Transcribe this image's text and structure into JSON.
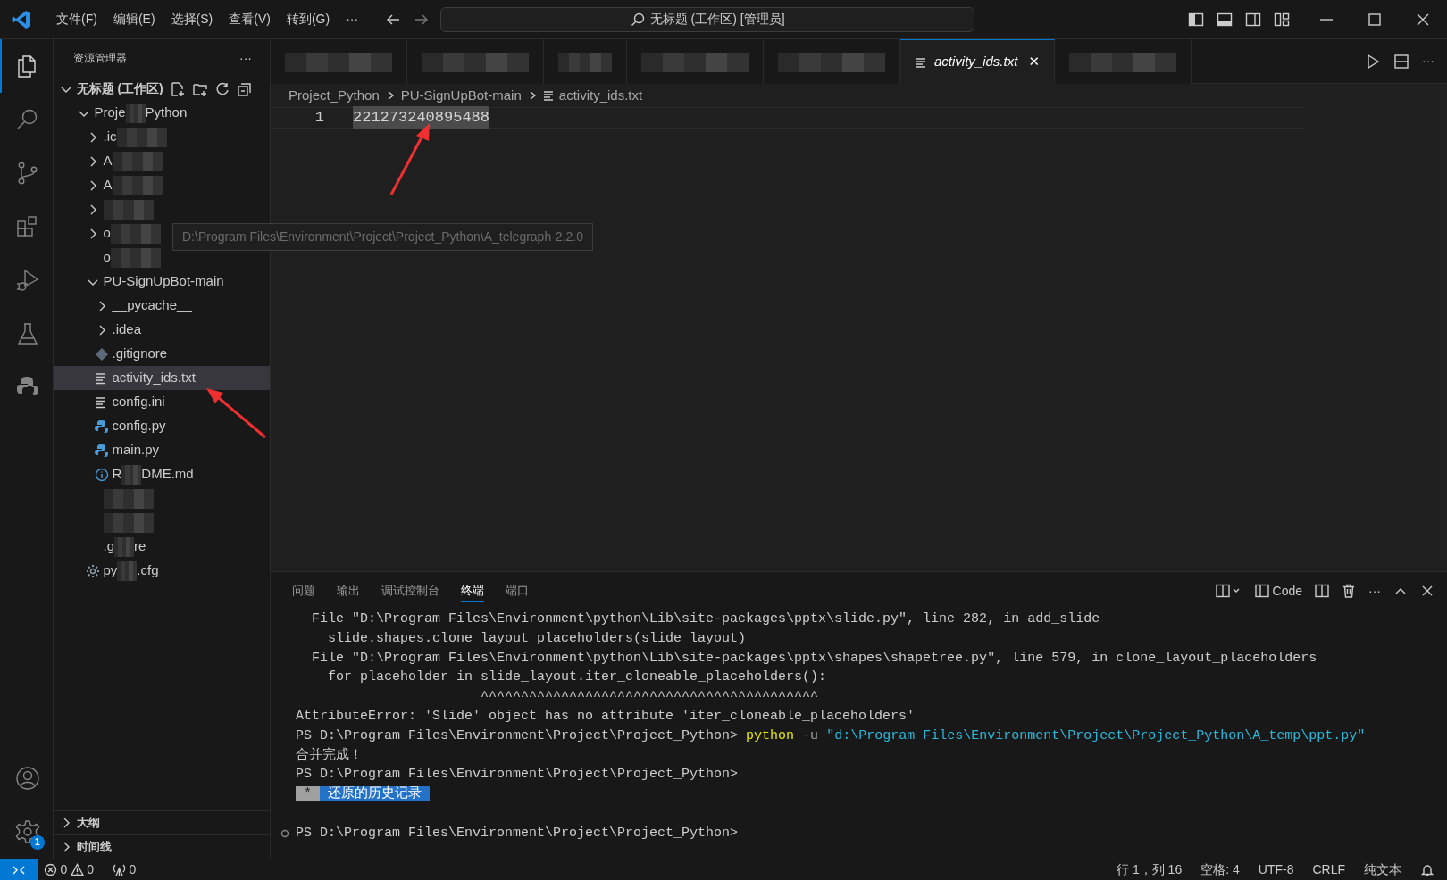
{
  "menu": [
    "文件(F)",
    "编辑(E)",
    "选择(S)",
    "查看(V)",
    "转到(G)",
    "···"
  ],
  "command_center": "无标题 (工作区) [管理员]",
  "activity_bar": [
    {
      "kind": "explorer",
      "selected": true
    },
    {
      "kind": "search",
      "selected": false
    },
    {
      "kind": "source-control",
      "selected": false
    },
    {
      "kind": "extensions",
      "selected": false
    },
    {
      "kind": "run-debug",
      "selected": false
    },
    {
      "kind": "testing",
      "selected": false
    },
    {
      "kind": "python",
      "selected": false
    }
  ],
  "activity_bottom": [
    {
      "kind": "accounts"
    },
    {
      "kind": "settings",
      "badge": "1"
    }
  ],
  "sidebar": {
    "title": "资源管理器",
    "more": "···",
    "workspace": "无标题 (工作区)",
    "tree": [
      {
        "kind": "folder",
        "parts": [
          "Proje",
          "Python"
        ],
        "redacted": true,
        "expanded": true,
        "selected": false,
        "children": [
          {
            "kind": "folder",
            "parts": [
              ".ic"
            ],
            "redacted": true,
            "expanded": false,
            "selected": false
          },
          {
            "kind": "folder",
            "parts": [
              "A"
            ],
            "redacted": true,
            "expanded": false,
            "selected": false
          },
          {
            "kind": "folder",
            "parts": [
              "A"
            ],
            "redacted": true,
            "expanded": false,
            "selected": false
          },
          {
            "kind": "folder",
            "redacted": true,
            "expanded": false,
            "selected": false
          },
          {
            "kind": "folder",
            "parts": [
              "o"
            ],
            "redacted": true,
            "expanded": false,
            "selected": false
          },
          {
            "kind": "blank",
            "parts": [
              "o"
            ],
            "redacted": true,
            "selected": false
          },
          {
            "kind": "folder",
            "parts": [
              "PU-SignUpBot-main"
            ],
            "redacted": false,
            "expanded": true,
            "selected": false,
            "children": [
              {
                "kind": "folder",
                "parts": [
                  "__pycache__"
                ],
                "redacted": false,
                "expanded": false,
                "selected": false
              },
              {
                "kind": "folder",
                "parts": [
                  ".idea"
                ],
                "redacted": false,
                "expanded": false,
                "selected": false
              },
              {
                "kind": "git",
                "parts": [
                  ".gitignore"
                ],
                "redacted": false,
                "selected": false
              },
              {
                "kind": "text",
                "parts": [
                  "activity_ids.txt"
                ],
                "redacted": false,
                "selected": true
              },
              {
                "kind": "text",
                "parts": [
                  "config.ini"
                ],
                "redacted": false,
                "selected": false
              },
              {
                "kind": "python",
                "parts": [
                  "config.py"
                ],
                "redacted": false,
                "selected": false
              },
              {
                "kind": "python",
                "parts": [
                  "main.py"
                ],
                "redacted": false,
                "selected": false
              },
              {
                "kind": "info",
                "parts": [
                  "R",
                  "DME.md"
                ],
                "redacted": true,
                "selected": false
              }
            ]
          },
          {
            "kind": "blank",
            "redacted": true,
            "selected": false
          },
          {
            "kind": "blank",
            "redacted": true,
            "selected": false
          },
          {
            "kind": "blank",
            "parts": [
              ".g",
              "re"
            ],
            "redacted": true,
            "selected": false
          },
          {
            "kind": "config",
            "parts": [
              "py",
              ".cfg"
            ],
            "redacted": true,
            "selected": false
          }
        ]
      }
    ],
    "sections": [
      "大纲",
      "时间线"
    ]
  },
  "tabs": [
    {
      "redacted": true,
      "selected": false
    },
    {
      "redacted": true,
      "selected": false
    },
    {
      "redacted": true,
      "selected": false
    },
    {
      "redacted": true,
      "selected": false
    },
    {
      "redacted": true,
      "selected": false
    },
    {
      "label": "activity_ids.txt",
      "close": "✕",
      "selected": true
    },
    {
      "redacted": true,
      "selected": false
    }
  ],
  "breadcrumb": [
    "Project_Python",
    "PU-SignUpBot-main",
    "activity_ids.txt"
  ],
  "editor": {
    "lines": [
      {
        "number": "1",
        "text": "221273240895488"
      }
    ]
  },
  "tooltip": "D:\\Program Files\\Environment\\Project\\Project_Python\\A_telegraph-2.2.0",
  "panel": {
    "tabs": [
      {
        "label": "问题",
        "selected": false
      },
      {
        "label": "输出",
        "selected": false
      },
      {
        "label": "调试控制台",
        "selected": false
      },
      {
        "label": "终端",
        "selected": true
      },
      {
        "label": "端口",
        "selected": false
      }
    ],
    "terminal_name": "Code",
    "lines": [
      {
        "kind": "plain",
        "text": "  File \"D:\\Program Files\\Environment\\python\\Lib\\site-packages\\pptx\\slide.py\", line 282, in add_slide"
      },
      {
        "kind": "plain",
        "text": "    slide.shapes.clone_layout_placeholders(slide_layout)"
      },
      {
        "kind": "plain",
        "text": "  File \"D:\\Program Files\\Environment\\python\\Lib\\site-packages\\pptx\\shapes\\shapetree.py\", line 579, in clone_layout_placeholders"
      },
      {
        "kind": "plain",
        "text": "    for placeholder in slide_layout.iter_cloneable_placeholders():"
      },
      {
        "kind": "plain",
        "text": "                       ^^^^^^^^^^^^^^^^^^^^^^^^^^^^^^^^^^^^^^^^^^"
      },
      {
        "kind": "plain",
        "text": "AttributeError: 'Slide' object has no attribute 'iter_cloneable_placeholders'"
      },
      {
        "kind": "command",
        "prompt": "PS D:\\Program Files\\Environment\\Project\\Project_Python>",
        "command": "python",
        "flag": "-u",
        "argument": "\"d:\\Program Files\\Environment\\Project\\Project_Python\\A_temp\\ppt.py\""
      },
      {
        "kind": "plain",
        "text": "合并完成！"
      },
      {
        "kind": "plain",
        "text": "PS D:\\Program Files\\Environment\\Project\\Project_Python>"
      },
      {
        "kind": "highlight",
        "mark": "*",
        "text": "还原的历史记录"
      },
      {
        "kind": "blank"
      },
      {
        "kind": "prompt",
        "text": "PS D:\\Program Files\\Environment\\Project\\Project_Python>"
      }
    ]
  },
  "status_bar": {
    "errors": "0",
    "warnings": "0",
    "ports": "0",
    "right": [
      "行 1，列 16",
      "空格: 4",
      "UTF-8",
      "CRLF",
      "纯文本"
    ]
  }
}
